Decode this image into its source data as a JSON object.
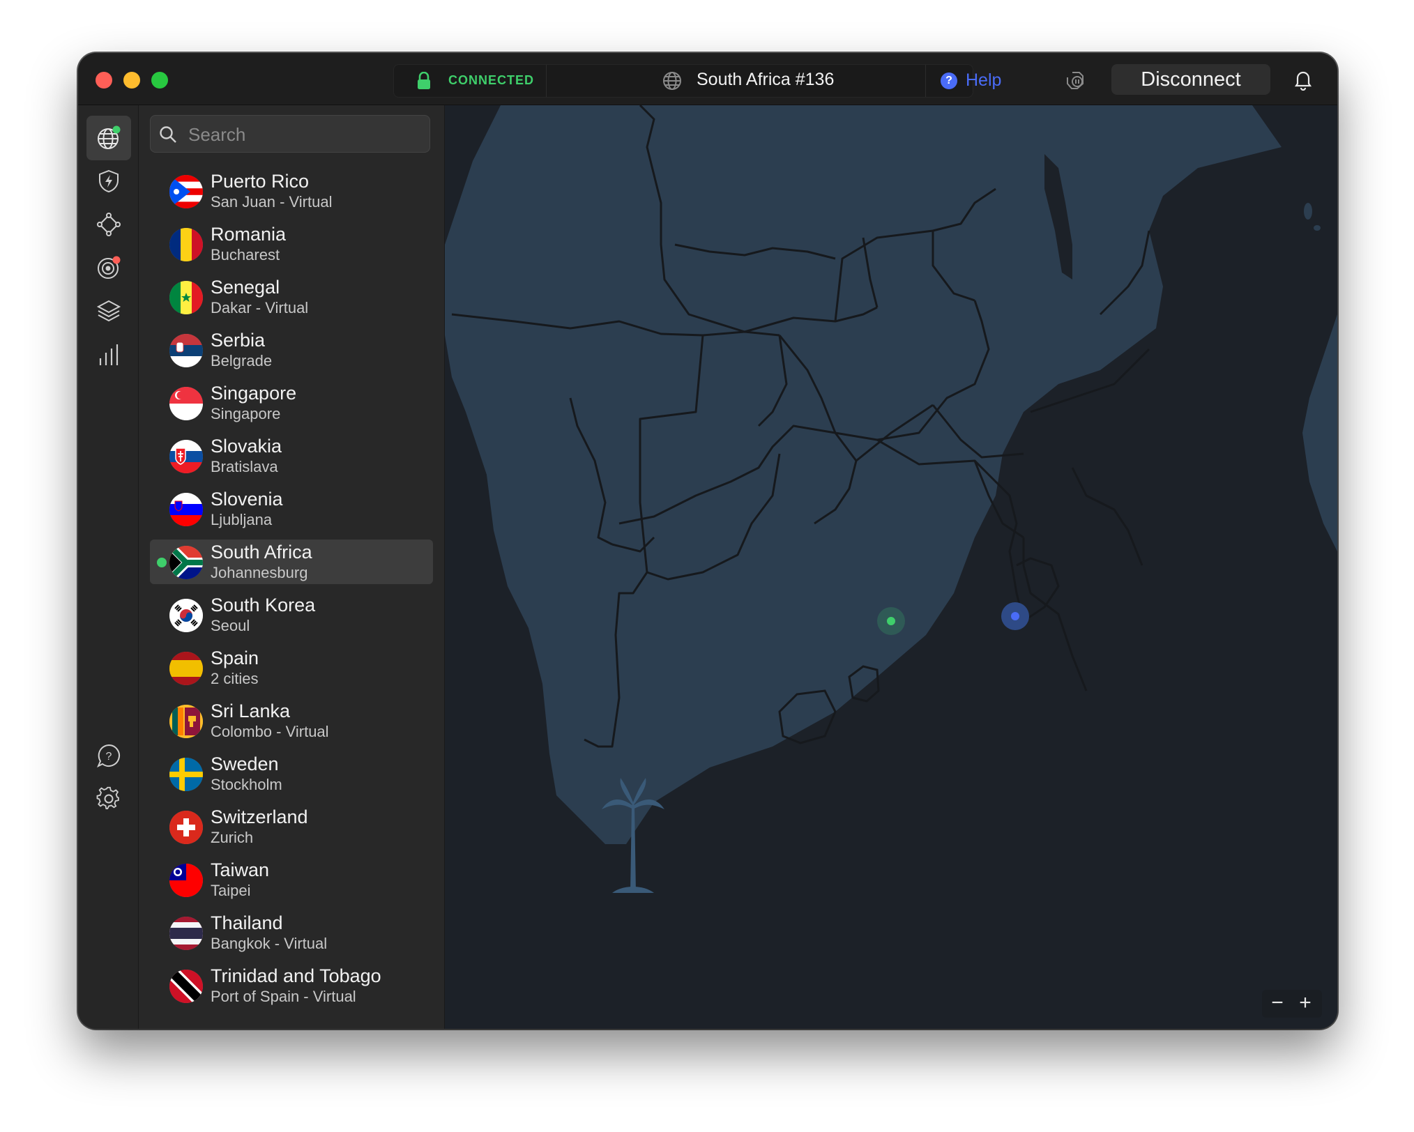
{
  "titlebar": {
    "status": "CONNECTED",
    "server": "South Africa #136",
    "help": "Help",
    "disconnect": "Disconnect"
  },
  "colors": {
    "accent_green": "#3fcf6b",
    "accent_blue": "#4a6cf7",
    "land": "#2c3e50",
    "ocean": "#1c2128"
  },
  "rail": {
    "icons": [
      "globe-icon",
      "shield-bolt-icon",
      "meshnet-icon",
      "radar-icon",
      "layers-icon",
      "stats-icon",
      "help-chat-icon",
      "settings-gear-icon"
    ]
  },
  "search": {
    "placeholder": "Search"
  },
  "countries": [
    {
      "name": "Puerto Rico",
      "city": "San Juan - Virtual"
    },
    {
      "name": "Romania",
      "city": "Bucharest"
    },
    {
      "name": "Senegal",
      "city": "Dakar - Virtual"
    },
    {
      "name": "Serbia",
      "city": "Belgrade"
    },
    {
      "name": "Singapore",
      "city": "Singapore"
    },
    {
      "name": "Slovakia",
      "city": "Bratislava"
    },
    {
      "name": "Slovenia",
      "city": "Ljubljana"
    },
    {
      "name": "South Africa",
      "city": "Johannesburg",
      "active": true
    },
    {
      "name": "South Korea",
      "city": "Seoul"
    },
    {
      "name": "Spain",
      "city": "2 cities"
    },
    {
      "name": "Sri Lanka",
      "city": "Colombo - Virtual"
    },
    {
      "name": "Sweden",
      "city": "Stockholm"
    },
    {
      "name": "Switzerland",
      "city": "Zurich"
    },
    {
      "name": "Taiwan",
      "city": "Taipei"
    },
    {
      "name": "Thailand",
      "city": "Bangkok - Virtual"
    },
    {
      "name": "Trinidad and Tobago",
      "city": "Port of Spain - Virtual"
    }
  ],
  "map": {
    "zoom_out": "−",
    "zoom_in": "+"
  }
}
